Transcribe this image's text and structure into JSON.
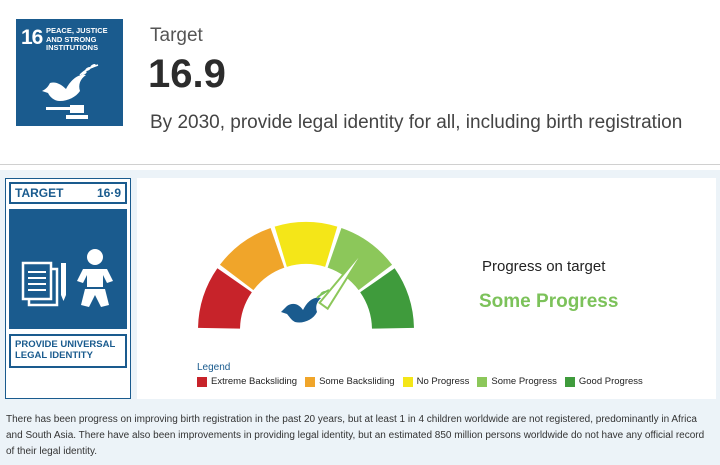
{
  "header": {
    "goal_number": "16",
    "goal_title": "PEACE, JUSTICE AND STRONG INSTITUTIONS",
    "target_label": "Target",
    "target_number": "16.9",
    "target_description": "By 2030, provide legal identity for all, including birth registration"
  },
  "card": {
    "label": "TARGET",
    "number": "16·9",
    "footer": "PROVIDE UNIVERSAL LEGAL IDENTITY",
    "color": "#1a5b8e"
  },
  "progress": {
    "caption": "Progress on target",
    "status": "Some Progress",
    "level": 4,
    "level_count": 5,
    "status_color": "#7cc25a"
  },
  "legend": {
    "title": "Legend",
    "items": [
      {
        "label": "Extreme Backsliding",
        "color": "#c7232a"
      },
      {
        "label": "Some Backsliding",
        "color": "#f0a52a"
      },
      {
        "label": "No Progress",
        "color": "#f4e618"
      },
      {
        "label": "Some Progress",
        "color": "#8cc75a"
      },
      {
        "label": "Good Progress",
        "color": "#3f9b3c"
      }
    ]
  },
  "summary": "There has been progress on improving birth registration in the past 20 years, but at least 1 in 4 children worldwide are not registered, predominantly in Africa and South Asia. There have also been improvements in providing legal identity, but an estimated 850 million persons worldwide do not have any official record of their legal identity."
}
